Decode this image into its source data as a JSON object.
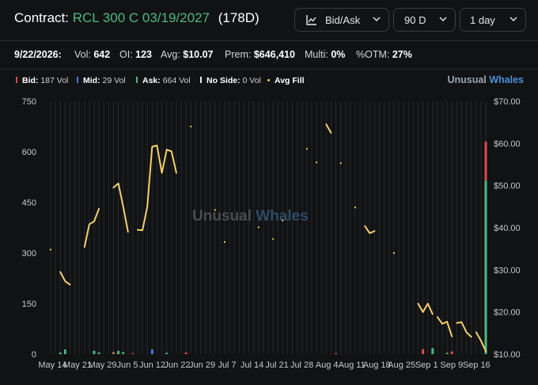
{
  "header": {
    "contract_label": "Contract:",
    "contract_symbol": "RCL 300 C 03/19/2027",
    "days_to_expiry": "(178D)",
    "mode_select": "Bid/Ask",
    "range_select": "90 D",
    "interval_select": "1 day"
  },
  "stats": {
    "date": "9/22/2026:",
    "vol_label": "Vol:",
    "vol_value": "642",
    "oi_label": "OI:",
    "oi_value": "123",
    "avg_label": "Avg:",
    "avg_value": "$10.07",
    "prem_label": "Prem:",
    "prem_value": "$646,410",
    "multi_label": "Multi:",
    "multi_value": "0%",
    "otm_label": "%OTM:",
    "otm_value": "27%"
  },
  "legend": {
    "bid_label": "Bid:",
    "bid_value": "187 Vol",
    "mid_label": "Mid:",
    "mid_value": "29 Vol",
    "ask_label": "Ask:",
    "ask_value": "664 Vol",
    "noside_label": "No Side:",
    "noside_value": "0 Vol",
    "avgfill_label": "Avg Fill"
  },
  "brand": {
    "part1": "Unusual",
    "part2": "Whales"
  },
  "watermark": {
    "part1": "Unusual",
    "part2": "Whales"
  },
  "colors": {
    "bid": "#d94a4a",
    "mid": "#4a78e0",
    "ask": "#4bb980",
    "avg_fill": "#f2d06b",
    "brand_accent": "#4a8fd6"
  },
  "chart_data": {
    "type": "bar+line",
    "x_tick_labels": [
      "May 14",
      "May 21",
      "May 29",
      "Jun 5",
      "Jun 12",
      "Jun 22",
      "Jun 29",
      "Jul 7",
      "Jul 14",
      "Jul 21",
      "Jul 28",
      "Aug 4",
      "Aug 11",
      "Aug 18",
      "Aug 25",
      "Sep 1",
      "Sep 9",
      "Sep 16"
    ],
    "left_axis": {
      "ticks": [
        "0",
        "150",
        "300",
        "450",
        "600",
        "750"
      ],
      "range": [
        0,
        750
      ]
    },
    "right_axis": {
      "ticks": [
        "$10.00",
        "$20.00",
        "$30.00",
        "$40.00",
        "$50.00",
        "$60.00",
        "$70.00"
      ],
      "range": [
        10,
        70
      ]
    },
    "num_days": 91,
    "volume_bars": [
      {
        "day": 2,
        "ask": 5
      },
      {
        "day": 3,
        "ask": 14
      },
      {
        "day": 9,
        "ask": 10
      },
      {
        "day": 10,
        "ask": 5
      },
      {
        "day": 13,
        "bid": 4,
        "ask": 3
      },
      {
        "day": 14,
        "ask": 10
      },
      {
        "day": 15,
        "ask": 6
      },
      {
        "day": 17,
        "bid": 3
      },
      {
        "day": 21,
        "mid": 14
      },
      {
        "day": 24,
        "ask": 4
      },
      {
        "day": 28,
        "bid": 5
      },
      {
        "day": 59,
        "bid": 3
      },
      {
        "day": 77,
        "bid": 15
      },
      {
        "day": 79,
        "ask": 18
      },
      {
        "day": 82,
        "ask": 4
      },
      {
        "day": 83,
        "bid": 8
      },
      {
        "day": 90,
        "bid": 115,
        "ask": 515
      }
    ],
    "avg_fill_segments": [
      [
        [
          0,
          34.8
        ]
      ],
      [
        [
          2,
          29.5
        ],
        [
          3,
          27.3
        ],
        [
          4,
          26.5
        ]
      ],
      [
        [
          7,
          35.4
        ],
        [
          8,
          40.8
        ],
        [
          9,
          41.5
        ],
        [
          10,
          44.5
        ]
      ],
      [
        [
          13,
          49.5
        ],
        [
          14,
          50.5
        ],
        [
          15,
          45.0
        ],
        [
          16,
          39.0
        ]
      ],
      [
        [
          18,
          39.5
        ],
        [
          19,
          39.4
        ],
        [
          20,
          45.0
        ],
        [
          21,
          59.2
        ],
        [
          22,
          59.5
        ],
        [
          23,
          53.0
        ],
        [
          24,
          58.5
        ],
        [
          25,
          58.1
        ],
        [
          26,
          53.0
        ]
      ],
      [
        [
          29,
          64.0
        ]
      ],
      [
        [
          34,
          44.2
        ]
      ],
      [
        [
          36,
          36.6
        ]
      ],
      [
        [
          43,
          40.1
        ]
      ],
      [
        [
          46,
          37.3
        ]
      ],
      [
        [
          48,
          41.7
        ]
      ],
      [
        [
          53,
          58.7
        ]
      ],
      [
        [
          55,
          55.5
        ]
      ],
      [
        [
          57,
          64.5
        ],
        [
          58,
          62.5
        ]
      ],
      [
        [
          60,
          55.3
        ]
      ],
      [
        [
          63,
          44.8
        ]
      ],
      [
        [
          65,
          40.4
        ],
        [
          66,
          38.7
        ],
        [
          67,
          39.2
        ]
      ],
      [
        [
          71,
          34.0
        ]
      ],
      [
        [
          76,
          22.0
        ],
        [
          77,
          20.0
        ],
        [
          78,
          22.0
        ],
        [
          79,
          19.5
        ]
      ],
      [
        [
          80,
          18.8
        ],
        [
          81,
          17.2
        ],
        [
          82,
          17.7
        ],
        [
          83,
          14.2
        ]
      ],
      [
        [
          84,
          17.4
        ],
        [
          85,
          17.6
        ],
        [
          86,
          15.2
        ],
        [
          87,
          14.1
        ]
      ],
      [
        [
          88,
          15.2
        ],
        [
          89,
          13.2
        ],
        [
          90,
          10.7
        ]
      ]
    ]
  }
}
